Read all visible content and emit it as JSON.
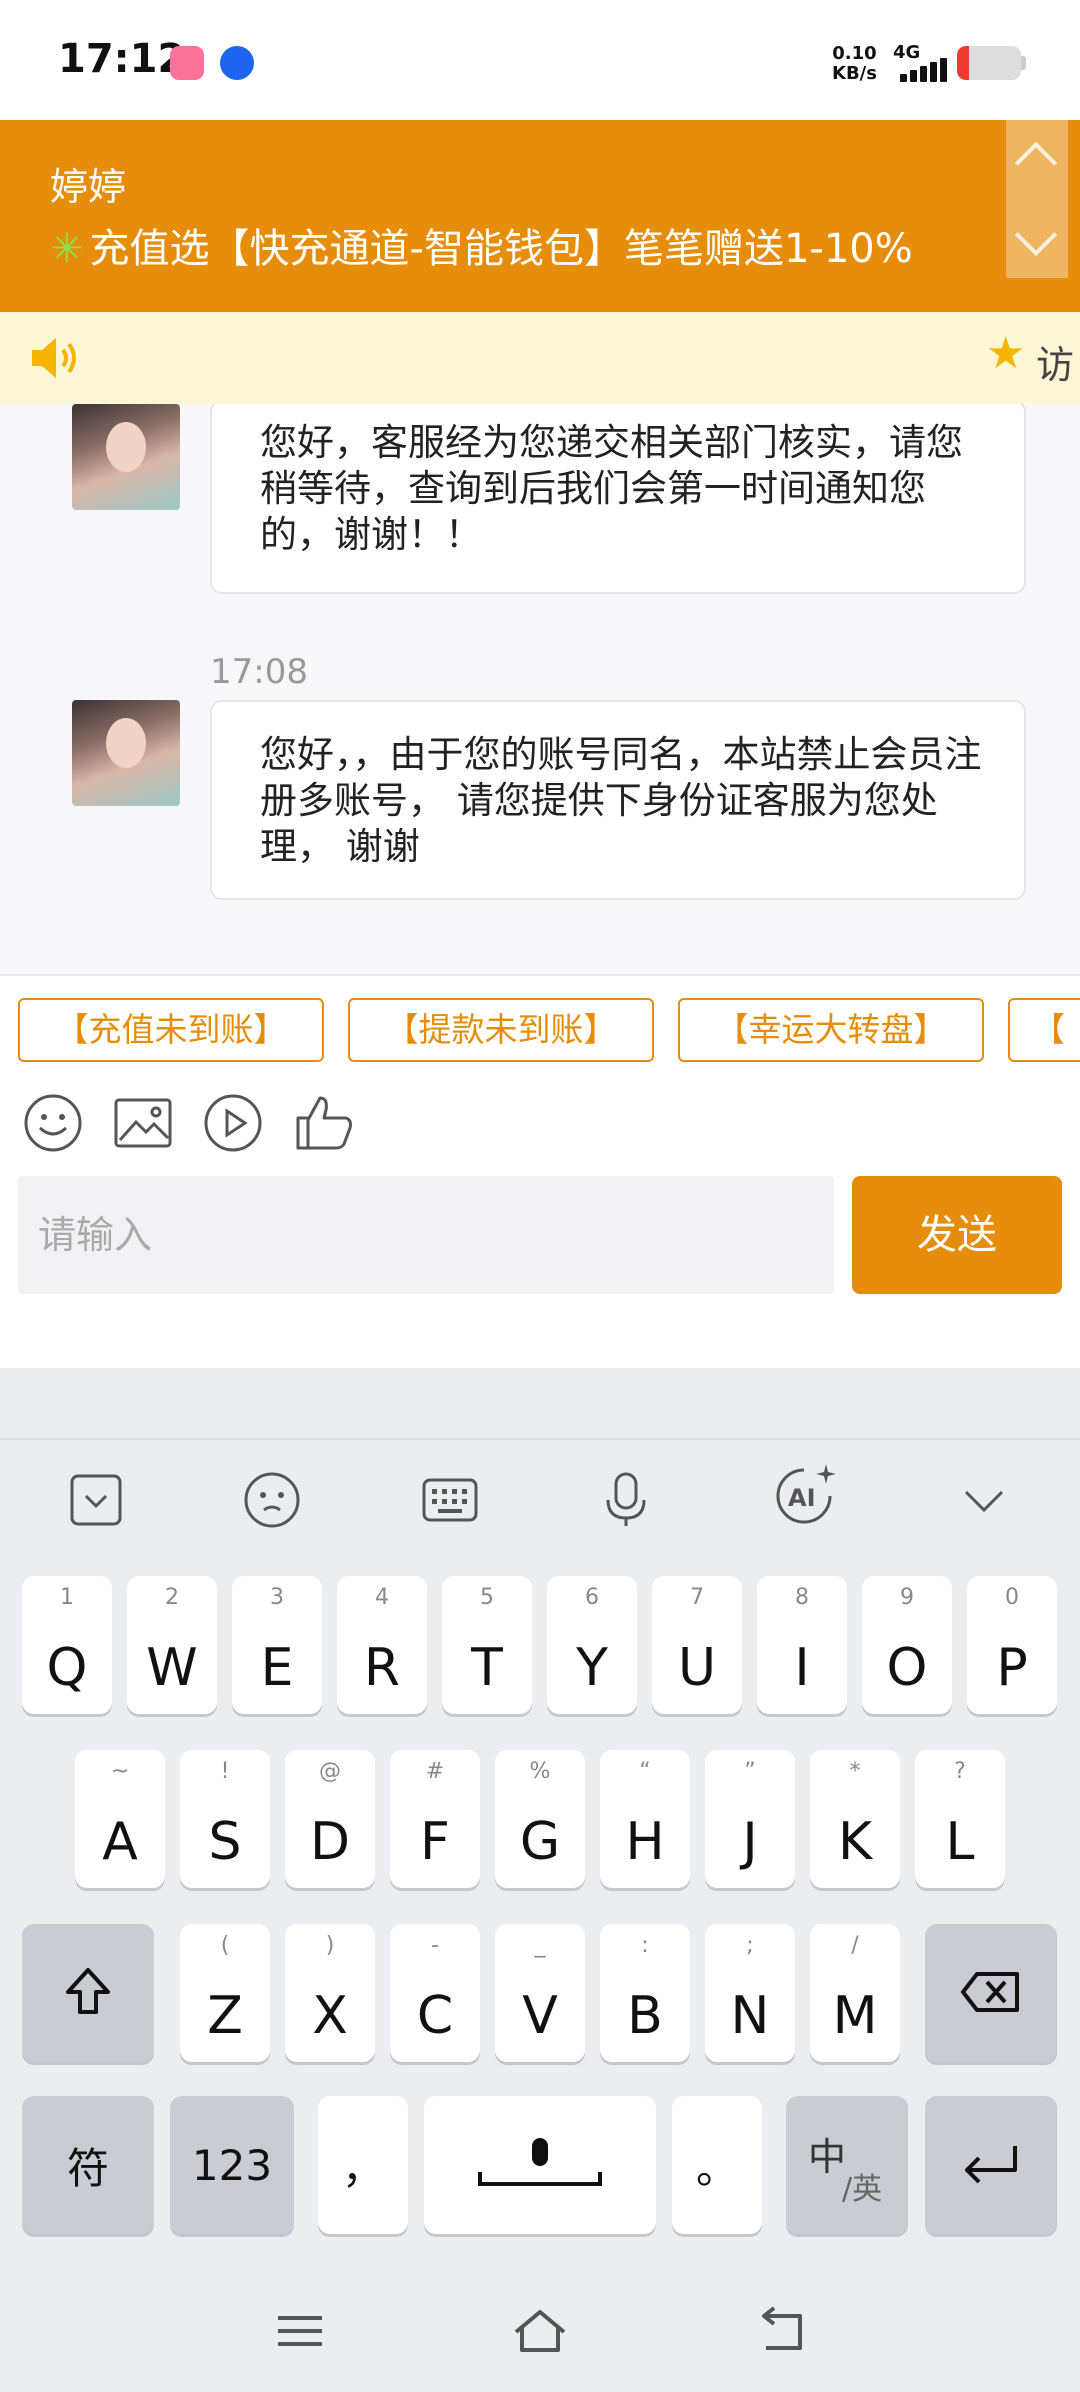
{
  "status_bar": {
    "time": "17:12",
    "net_speed_value": "0.10",
    "net_speed_unit": "KB/s",
    "network_type": "4G",
    "battery_level": 0.18,
    "battery_color": "#f03b30"
  },
  "header": {
    "agent_name": "婷婷",
    "promo_text": "充值选【快充通道-智能钱包】笔笔赠送1-10%",
    "promo_icon": "✳",
    "accent_color": "#e68d0b"
  },
  "notice": {
    "icon": "speaker-icon",
    "text": "访"
  },
  "messages": [
    {
      "time": "",
      "text": "您好，客服经为您递交相关部门核实，请您稍等待，查询到后我们会第一时间通知您的，谢谢！！"
    },
    {
      "time": "17:08",
      "text": "您好，，由于您的账号同名，本站禁止会员注册多账号， 请您提供下身份证客服为您处理， 谢谢"
    }
  ],
  "quick_replies": [
    "【充值未到账】",
    "【提款未到账】",
    "【幸运大转盘】",
    "【"
  ],
  "compose": {
    "placeholder": "请输入",
    "send_label": "发送"
  },
  "keyboard": {
    "row1": [
      {
        "key": "Q",
        "sub": "1"
      },
      {
        "key": "W",
        "sub": "2"
      },
      {
        "key": "E",
        "sub": "3"
      },
      {
        "key": "R",
        "sub": "4"
      },
      {
        "key": "T",
        "sub": "5"
      },
      {
        "key": "Y",
        "sub": "6"
      },
      {
        "key": "U",
        "sub": "7"
      },
      {
        "key": "I",
        "sub": "8"
      },
      {
        "key": "O",
        "sub": "9"
      },
      {
        "key": "P",
        "sub": "0"
      }
    ],
    "row2": [
      {
        "key": "A",
        "sub": "~"
      },
      {
        "key": "S",
        "sub": "!"
      },
      {
        "key": "D",
        "sub": "@"
      },
      {
        "key": "F",
        "sub": "#"
      },
      {
        "key": "G",
        "sub": "%"
      },
      {
        "key": "H",
        "sub": "“"
      },
      {
        "key": "J",
        "sub": "”"
      },
      {
        "key": "K",
        "sub": "*"
      },
      {
        "key": "L",
        "sub": "?"
      }
    ],
    "row3": [
      {
        "key": "Z",
        "sub": "("
      },
      {
        "key": "X",
        "sub": ")"
      },
      {
        "key": "C",
        "sub": "-"
      },
      {
        "key": "V",
        "sub": "_"
      },
      {
        "key": "B",
        "sub": ":"
      },
      {
        "key": "N",
        "sub": ";"
      },
      {
        "key": "M",
        "sub": "/"
      }
    ],
    "symbols_label": "符",
    "numbers_label": "123",
    "comma_label": "，",
    "period_label": "。",
    "lang_primary": "中",
    "lang_secondary": "/英"
  }
}
